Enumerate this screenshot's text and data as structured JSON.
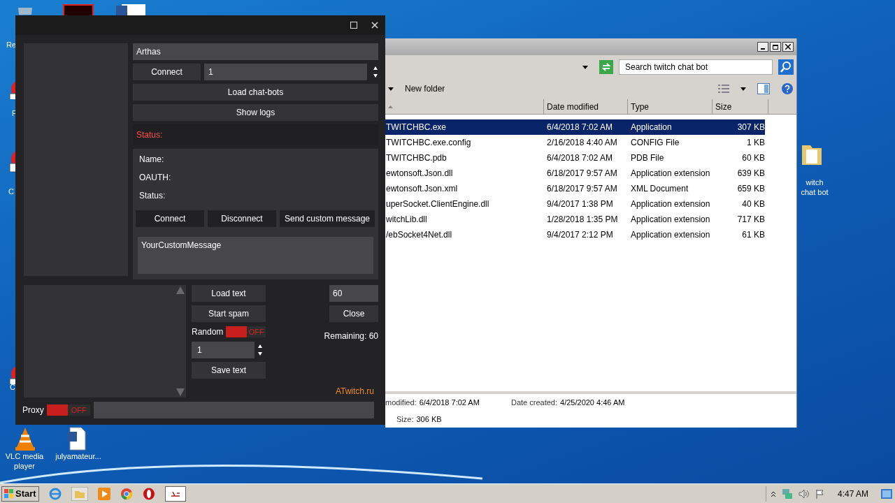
{
  "desktop_icons": [
    {
      "label": "Re",
      "kind": "bin"
    },
    {
      "label": "F",
      "kind": "app"
    },
    {
      "label": "C",
      "kind": "app"
    },
    {
      "label": "C",
      "kind": "app"
    },
    {
      "label": "VLC media player",
      "kind": "vlc"
    },
    {
      "label": "julyamateur...",
      "kind": "doc"
    },
    {
      "label": "witch chat bot",
      "kind": "folder"
    }
  ],
  "explorer": {
    "search_placeholder": "Search twitch chat bot",
    "new_folder": "New folder",
    "columns": [
      {
        "kind": "sort"
      },
      {
        "label": "Date modified"
      },
      {
        "label": "Type"
      },
      {
        "label": "Size"
      }
    ],
    "rows": [
      {
        "name": "TWITCHBC.exe",
        "date": "6/4/2018 7:02 AM",
        "type": "Application",
        "size": "307 KB",
        "selected": true
      },
      {
        "name": "TWITCHBC.exe.config",
        "date": "2/16/2018 4:40 AM",
        "type": "CONFIG File",
        "size": "1 KB",
        "selected": false
      },
      {
        "name": "TWITCHBC.pdb",
        "date": "6/4/2018 7:02 AM",
        "type": "PDB File",
        "size": "60 KB",
        "selected": false
      },
      {
        "name": "ewtonsoft.Json.dll",
        "date": "6/18/2017 9:57 AM",
        "type": "Application extension",
        "size": "639 KB",
        "selected": false
      },
      {
        "name": "ewtonsoft.Json.xml",
        "date": "6/18/2017 9:57 AM",
        "type": "XML Document",
        "size": "659 KB",
        "selected": false
      },
      {
        "name": "uperSocket.ClientEngine.dll",
        "date": "9/4/2017 1:38 PM",
        "type": "Application extension",
        "size": "40 KB",
        "selected": false
      },
      {
        "name": "witchLib.dll",
        "date": "1/28/2018 1:35 PM",
        "type": "Application extension",
        "size": "717 KB",
        "selected": false
      },
      {
        "name": "/ebSocket4Net.dll",
        "date": "9/4/2017 2:12 PM",
        "type": "Application extension",
        "size": "61 KB",
        "selected": false
      }
    ],
    "details": [
      {
        "label": "modified:",
        "value": "6/4/2018 7:02 AM"
      },
      {
        "label": "Date created:",
        "value": "4/25/2020 4:46 AM"
      },
      {
        "label": "Size:",
        "value": "306 KB"
      }
    ]
  },
  "app": {
    "name_value": "Arthas",
    "connect": "Connect",
    "count_value": "1",
    "load_bots": "Load chat-bots",
    "show_logs": "Show logs",
    "status": "Status:",
    "info": [
      "Name:",
      "OAUTH:",
      "Status:"
    ],
    "bot_buttons": [
      "Connect",
      "Disconnect",
      "Send custom message"
    ],
    "message_value": "YourCustomMessage",
    "load_text": "Load text",
    "start_spam": "Start spam",
    "random": {
      "label": "Random",
      "state_text": "OFF",
      "on": false
    },
    "delay_value": "1",
    "save_text": "Save text",
    "limit_value": "60",
    "close": "Close",
    "remaining": "Remaining: 60",
    "site": "ATwitch.ru",
    "proxy": {
      "label": "Proxy",
      "state_text": "OFF",
      "on": false
    }
  },
  "taskbar": {
    "start": "Start",
    "time": "4:47 AM"
  }
}
